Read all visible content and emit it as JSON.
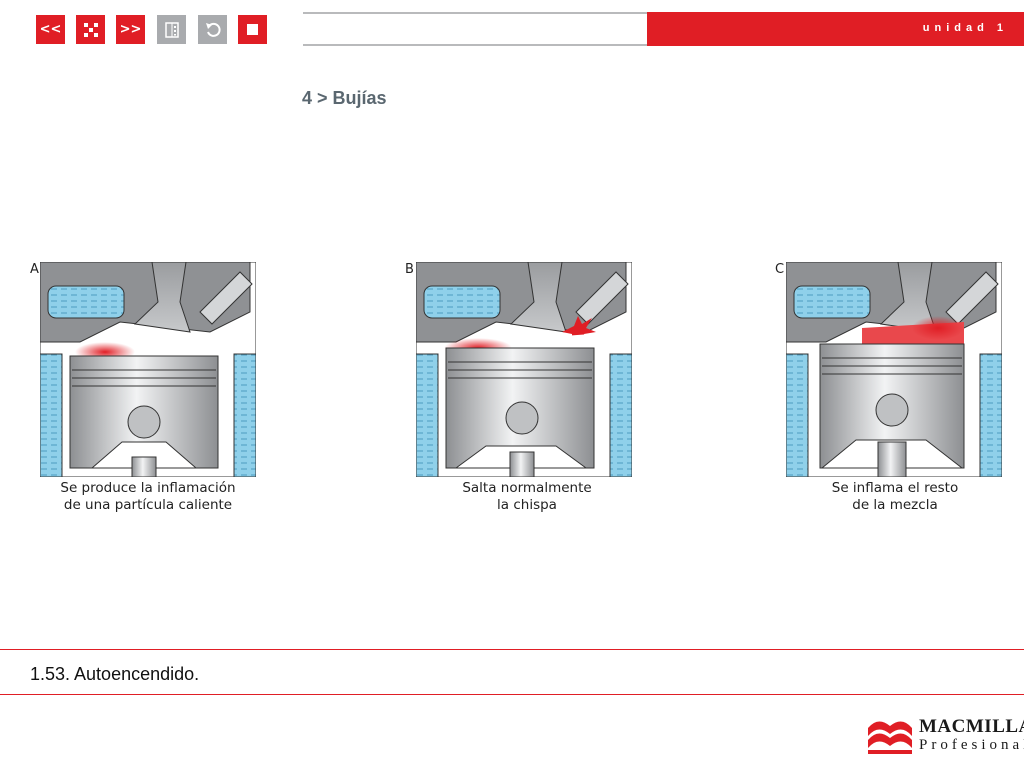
{
  "nav": {
    "prev_label": "<<",
    "next_label": ">>",
    "menu_icon": "dice-icon",
    "index_icon": "index-icon",
    "back_icon": "undo-icon",
    "stop_icon": "stop-icon"
  },
  "header": {
    "unit": "unidad 1"
  },
  "section_title": "4 > Bujías",
  "figures": [
    {
      "letter": "A",
      "caption_line1": "Se produce la inflamación",
      "caption_line2": "de una partícula caliente"
    },
    {
      "letter": "B",
      "caption_line1": "Salta normalmente",
      "caption_line2": "la chispa"
    },
    {
      "letter": "C",
      "caption_line1": "Se inflama el resto",
      "caption_line2": "de la mezcla"
    }
  ],
  "figure_caption": "1.53. Autoencendido.",
  "logo": {
    "line1": "MACMILLAN",
    "line2": "Profesional"
  },
  "colors": {
    "accent": "#e01e25",
    "grey": "#a9abae",
    "title": "#5a6770",
    "coolant": "#8fd0ea"
  }
}
